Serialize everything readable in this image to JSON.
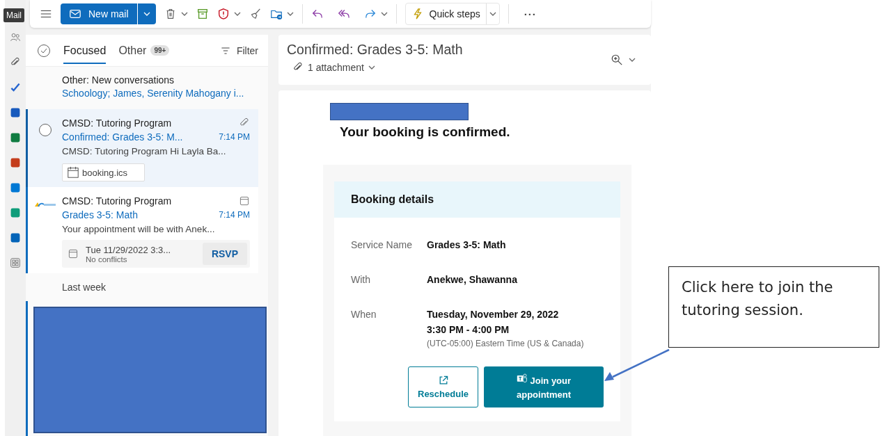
{
  "tooltip": "Mail",
  "toolbar": {
    "new_mail": "New mail",
    "quick_steps": "Quick steps",
    "more": "···"
  },
  "mail_list": {
    "tabs": [
      {
        "label": "Focused",
        "selected": true
      },
      {
        "label": "Other",
        "selected": false,
        "badge": "99+"
      }
    ],
    "filter": "Filter",
    "other_banner": {
      "title": "Other: New conversations",
      "senders": "Schoology; James, Serenity Mahogany i..."
    },
    "messages": [
      {
        "kind": "attachment",
        "selected": true,
        "sender": "CMSD: Tutoring Program",
        "subject": "Confirmed: Grades 3-5: M...",
        "time": "7:14 PM",
        "preview": "CMSD: Tutoring Program Hi Layla Ba...",
        "attachment": "booking.ics"
      },
      {
        "kind": "invite",
        "selected": false,
        "sender": "CMSD: Tutoring Program",
        "subject": "Grades 3-5: Math",
        "time": "7:14 PM",
        "preview": "Your appointment will be with Anek...",
        "invite_date": "Tue 11/29/2022 3:3...",
        "invite_status": "No conflicts",
        "rsvp": "RSVP"
      }
    ],
    "group_header": "Last week"
  },
  "reading": {
    "subject": "Confirmed: Grades 3-5: Math",
    "attachments": "1 attachment",
    "heading": "Your booking is confirmed.",
    "details_title": "Booking details",
    "details": [
      {
        "label": "Service Name",
        "lines": [
          "Grades 3-5: Math"
        ]
      },
      {
        "label": "With",
        "lines": [
          "Anekwe, Shawanna"
        ]
      },
      {
        "label": "When",
        "lines": [
          "Tuesday, November 29, 2022",
          "3:30 PM - 4:00 PM"
        ],
        "note": "(UTC-05:00) Eastern Time (US & Canada)"
      }
    ],
    "buttons": [
      {
        "kind": "outline",
        "label": "Reschedule"
      },
      {
        "kind": "filled",
        "label": "Join your appointment"
      }
    ]
  },
  "callout": "Click here to join the tutoring session."
}
